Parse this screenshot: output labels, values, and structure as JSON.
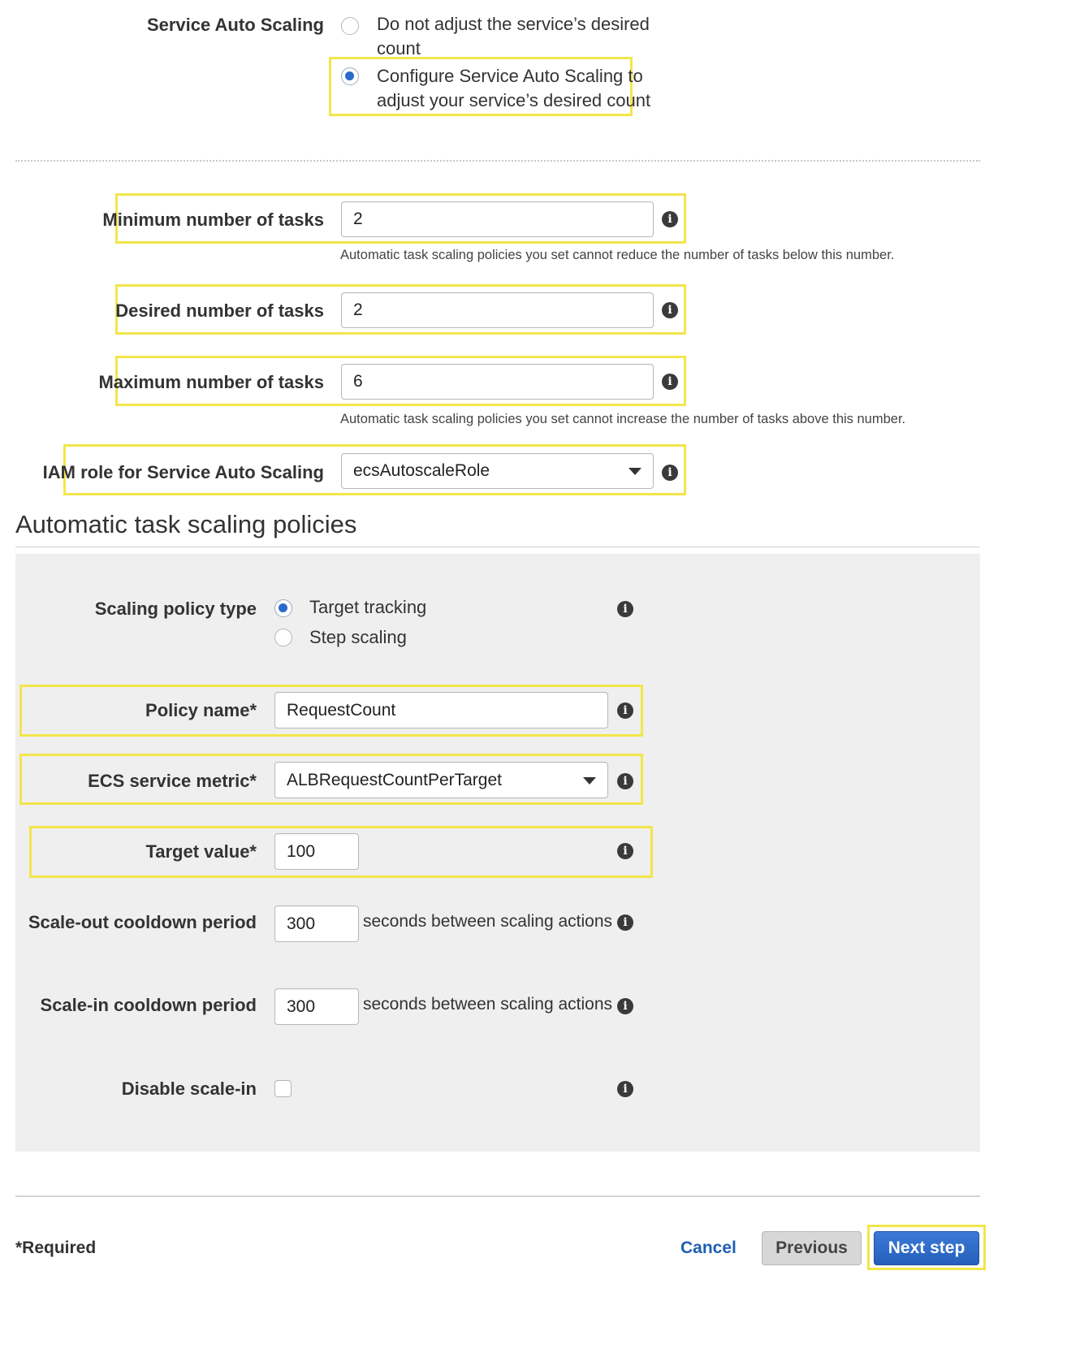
{
  "service_auto_scaling": {
    "label": "Service Auto Scaling",
    "option_no_adjust": "Do not adjust the service's desired count",
    "option_no_adjust_line1": "Do not adjust the service’s desired",
    "option_no_adjust_line2": "count",
    "option_configure_line1": "Configure Service Auto Scaling to",
    "option_configure_line2": "adjust your service’s desired count",
    "selected": "configure"
  },
  "tasks": {
    "min_label": "Minimum number of tasks",
    "min_value": "2",
    "min_hint": "Automatic task scaling policies you set cannot reduce the number of tasks below this number.",
    "desired_label": "Desired number of tasks",
    "desired_value": "2",
    "max_label": "Maximum number of tasks",
    "max_value": "6",
    "max_hint": "Automatic task scaling policies you set cannot increase the number of tasks above this number.",
    "iam_label": "IAM role for Service Auto Scaling",
    "iam_value": "ecsAutoscaleRole"
  },
  "policies": {
    "heading": "Automatic task scaling policies",
    "policy_type_label": "Scaling policy type",
    "policy_type_target": "Target tracking",
    "policy_type_step": "Step scaling",
    "policy_type_selected": "target",
    "policy_name_label": "Policy name*",
    "policy_name_value": "RequestCount",
    "metric_label": "ECS service metric*",
    "metric_value": "ALBRequestCountPerTarget",
    "target_label": "Target value*",
    "target_value": "100",
    "scale_out_label": "Scale-out cooldown period",
    "scale_out_value": "300",
    "scale_out_unit": "seconds between scaling actions",
    "scale_in_label": "Scale-in cooldown period",
    "scale_in_value": "300",
    "scale_in_unit": "seconds between scaling actions",
    "disable_label": "Disable scale-in",
    "disable_checked": false
  },
  "footer": {
    "required": "*Required",
    "cancel": "Cancel",
    "previous": "Previous",
    "next": "Next step"
  },
  "icons": {
    "info": "i"
  },
  "colors": {
    "highlight": "#f2e64a",
    "accent": "#2a6ac9",
    "link": "#1f5fb3",
    "panel": "#efefef"
  }
}
